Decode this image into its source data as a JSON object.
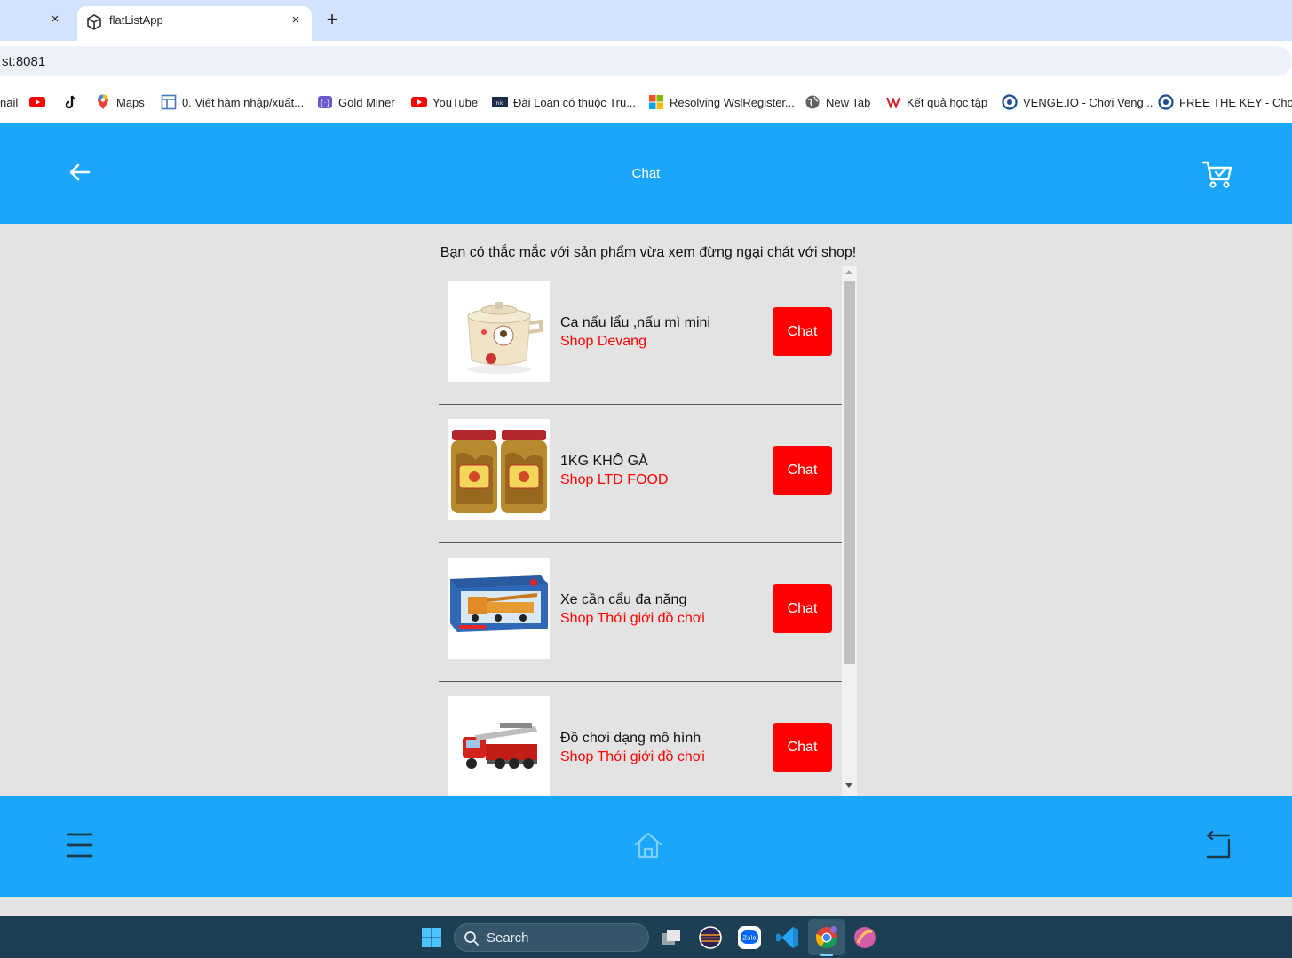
{
  "browser": {
    "tab_title": "flatListApp",
    "prev_tab_close": "×",
    "tab_close": "×",
    "new_tab": "+",
    "url": "st:8081",
    "bookmarks": [
      {
        "label": "nail",
        "icon": "gmail-icon"
      },
      {
        "label": "",
        "icon": "youtube-icon"
      },
      {
        "label": "",
        "icon": "tiktok-icon"
      },
      {
        "label": "Maps",
        "icon": "maps-icon"
      },
      {
        "label": "0. Viết hàm nhập/xuất...",
        "icon": "doc-icon"
      },
      {
        "label": "Gold Miner",
        "icon": "game-icon"
      },
      {
        "label": "YouTube",
        "icon": "youtube-icon"
      },
      {
        "label": "Đài Loan có thuộc Tru...",
        "icon": "news-icon"
      },
      {
        "label": "Resolving WslRegister...",
        "icon": "microsoft-icon"
      },
      {
        "label": "New Tab",
        "icon": "globe-icon"
      },
      {
        "label": "Kết quả học tập",
        "icon": "school-icon"
      },
      {
        "label": "VENGE.IO - Chơi Veng...",
        "icon": "venge-icon"
      },
      {
        "label": "FREE THE KEY - Chơi F...",
        "icon": "venge-icon"
      }
    ]
  },
  "app": {
    "header_title": "Chat",
    "intro": "Bạn có thắc mắc với sản phẩm vừa xem đừng ngại chát với shop!",
    "items": [
      {
        "name": "Ca nấu lẩu ,nấu mì mini",
        "shop": "Shop Devang",
        "button": "Chat",
        "image": "mini-hotpot-cooker"
      },
      {
        "name": "1KG KHÔ GÀ",
        "shop": "Shop LTD FOOD",
        "button": "Chat",
        "image": "dried-chicken-jars"
      },
      {
        "name": "Xe cần cẩu đa năng",
        "shop": "Shop Thới giới đồ chơi",
        "button": "Chat",
        "image": "crane-truck-toy-box"
      },
      {
        "name": "Đồ chơi dạng mô hình",
        "shop": "Shop Thới giới đồ chơi",
        "button": "Chat",
        "image": "fire-truck-model"
      }
    ],
    "colors": {
      "bar": "#1aa7fb",
      "button": "#ff0000",
      "shop_text": "#ff0000",
      "background": "#e3e3e3"
    }
  },
  "taskbar": {
    "search_label": "Search",
    "apps": [
      "task-view-icon",
      "eclipse-icon",
      "zalo-icon",
      "vscode-icon",
      "chrome-icon",
      "other-app-icon"
    ]
  }
}
